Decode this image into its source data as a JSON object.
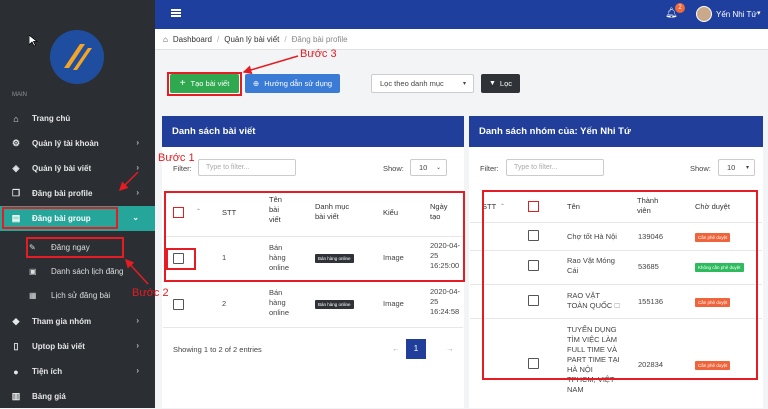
{
  "sidebar": {
    "section_label": "MAIN",
    "items": [
      {
        "label": "Trang chủ",
        "icon": "home-icon"
      },
      {
        "label": "Quản lý tài khoản",
        "icon": "gear-icon"
      },
      {
        "label": "Quản lý bài viết",
        "icon": "tag-icon"
      },
      {
        "label": "Đăng bài profile",
        "icon": "copy-icon"
      },
      {
        "label": "Đăng bài group",
        "icon": "group-post-icon"
      },
      {
        "label": "Tham gia nhóm",
        "icon": "layers-icon"
      },
      {
        "label": "Uptop bài viết",
        "icon": "book-icon"
      },
      {
        "label": "Tiện ích",
        "icon": "circle-icon"
      },
      {
        "label": "Bảng giá",
        "icon": "table-icon"
      }
    ],
    "sub_items": [
      {
        "label": "Đăng ngay",
        "icon": "pencil-icon"
      },
      {
        "label": "Danh sách lịch đăng",
        "icon": "save-icon"
      },
      {
        "label": "Lịch sử đăng bài",
        "icon": "calendar-icon"
      }
    ]
  },
  "topbar": {
    "notification_count": "2",
    "user_name": "Yến Nhi Tứ"
  },
  "breadcrumb": {
    "home": "Dashboard",
    "parent": "Quản lý bài viết",
    "current": "Đăng bài profile"
  },
  "toolbar": {
    "create_label": "Tạo bài viết",
    "guide_label": "Hướng dẫn sử dụng",
    "category_select": "Lọc theo danh mục",
    "filter_label": "Lọc"
  },
  "posts_panel": {
    "title": "Danh sách bài viết",
    "filter_label": "Filter:",
    "filter_placeholder": "Type to filter...",
    "show_label": "Show:",
    "show_value": "10",
    "columns": [
      "STT",
      "Tên bài viết",
      "Danh mục bài viết",
      "Kiểu",
      "Ngày tạo"
    ],
    "rows": [
      {
        "stt": "1",
        "name": "Bán hàng online",
        "category": "Bán hàng online",
        "type": "Image",
        "date": "2020-04-25 16:25:00"
      },
      {
        "stt": "2",
        "name": "Bán hàng online",
        "category": "Bán hàng online",
        "type": "Image",
        "date": "2020-04-25 16:24:58"
      }
    ],
    "footer": "Showing 1 to 2 of 2 entries",
    "page": "1"
  },
  "groups_panel": {
    "title": "Danh sách nhóm của: Yến Nhi Tứ",
    "filter_label": "Filter:",
    "filter_placeholder": "Type to filter...",
    "show_label": "Show:",
    "show_value": "10",
    "columns": [
      "STT",
      "Tên",
      "Thành viên",
      "Chờ duyệt"
    ],
    "rows": [
      {
        "name": "Chợ tốt Hà Nội",
        "members": "139046",
        "status": "Cần phê duyệt",
        "status_color": "#f0643c"
      },
      {
        "name": "Rao Vặt Móng Cái",
        "members": "53685",
        "status": "Không cần phê duyệt",
        "status_color": "#2dbb5d"
      },
      {
        "name": "RAO VẶT TOÀN QUỐC 🗆",
        "members": "155136",
        "status": "Cần phê duyệt",
        "status_color": "#f0643c"
      },
      {
        "name": "TUYỂN DỤNG TÌM VIỆC LÀM FULL TIME VÀ PART TIME TẠI HÀ NỘI TPHCM, VIỆT NAM",
        "members": "202834",
        "status": "Cần phê duyệt",
        "status_color": "#f0643c"
      }
    ]
  },
  "annotations": {
    "step1": "Bước 1",
    "step2": "Bước 2",
    "step3": "Bước 3"
  }
}
